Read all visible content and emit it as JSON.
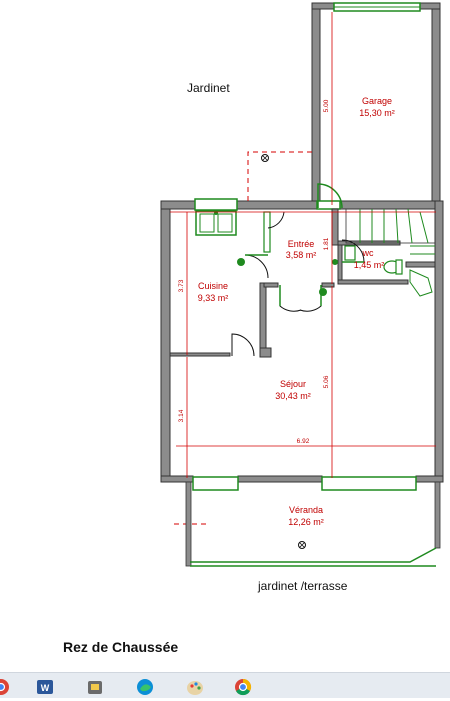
{
  "plan": {
    "outside_top": "Jardinet",
    "outside_bottom": "jardinet /terrasse",
    "caption": "Rez de Chaussée",
    "rooms": {
      "garage": {
        "name": "Garage",
        "area": "15,30 m²"
      },
      "entree": {
        "name": "Entrée",
        "area": "3,58 m²"
      },
      "wc": {
        "name": "wc",
        "area": "1,45 m²"
      },
      "cuisine": {
        "name": "Cuisine",
        "area": "9,33 m²"
      },
      "sejour": {
        "name": "Séjour",
        "area": "30,43 m²"
      },
      "veranda": {
        "name": "Véranda",
        "area": "12,26 m²"
      }
    },
    "dimensions": {
      "garage_depth": "5.00",
      "entree_depth": "1.81",
      "cuisine_depth": "3.73",
      "lower_left_depth": "3.14",
      "sejour_depth": "5.06",
      "total_width": "6.92"
    }
  },
  "colors": {
    "wall": "#8c8c8c",
    "wall_dark": "#333333",
    "window_green": "#1f8a1f",
    "dimension_red": "#d40000"
  },
  "taskbar": {
    "icons": [
      "chrome-icon",
      "word-icon",
      "app-icon",
      "edge-icon",
      "paint-icon",
      "chrome-icon"
    ]
  }
}
